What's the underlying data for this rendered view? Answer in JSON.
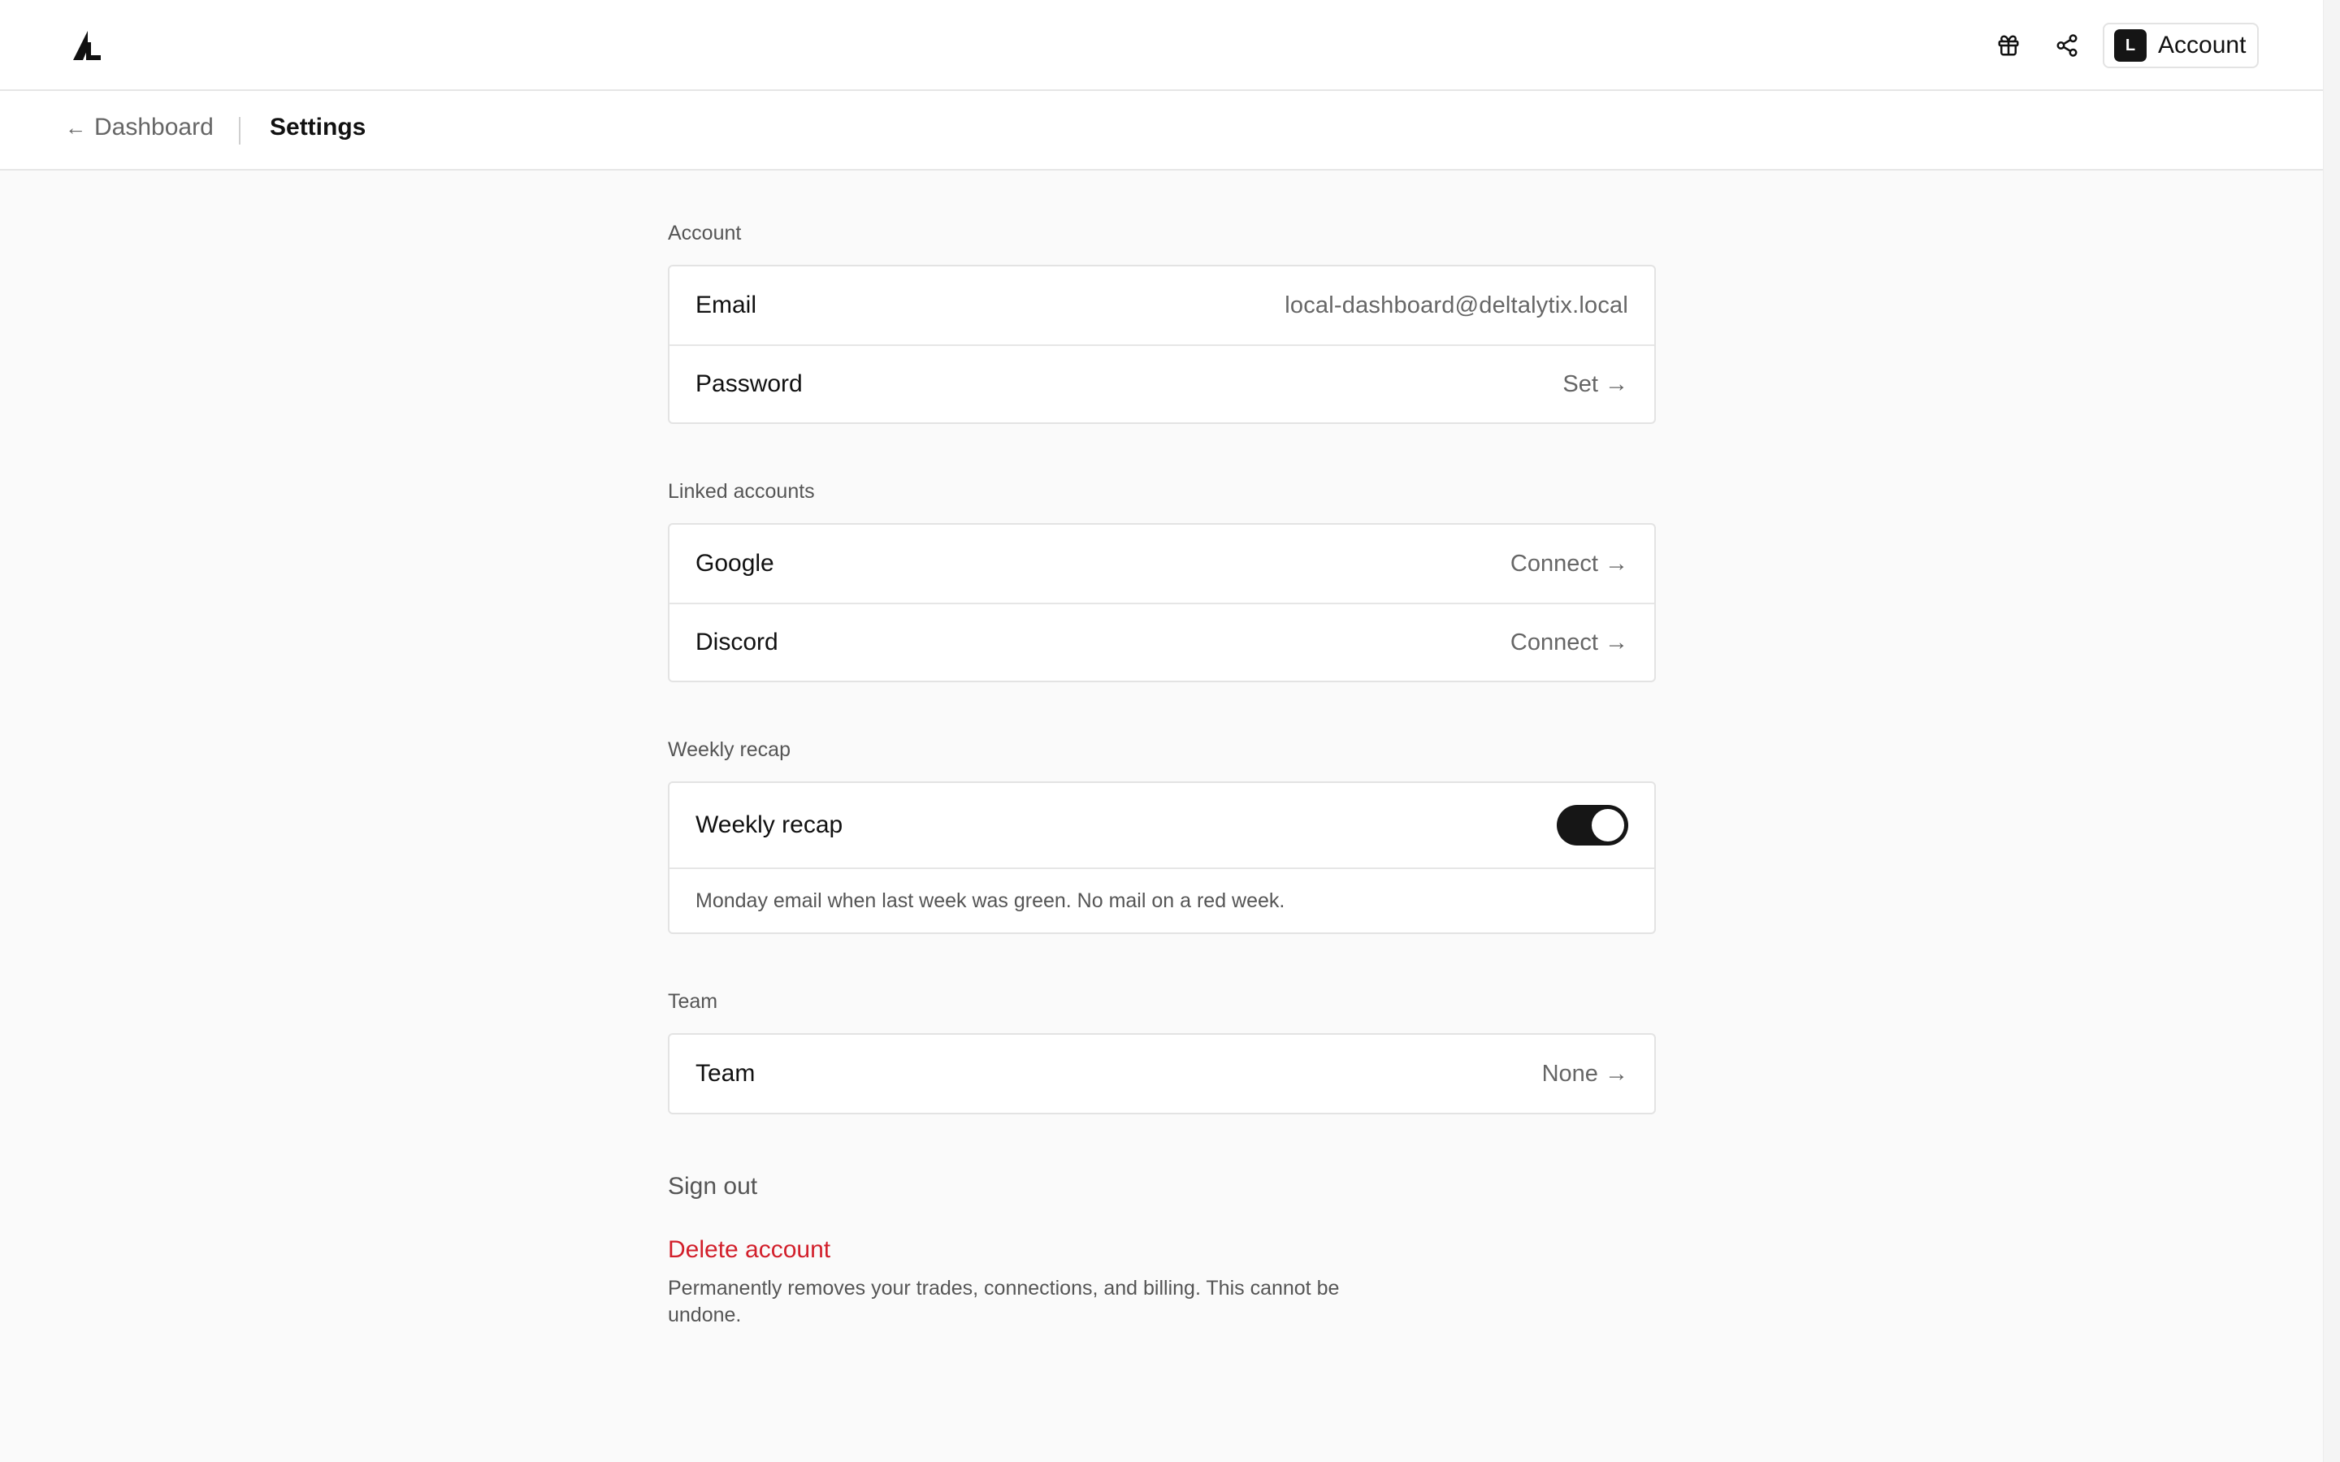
{
  "header": {
    "account_label": "Account",
    "avatar_initial": "L"
  },
  "breadcrumb": {
    "back_label": "Dashboard",
    "current": "Settings"
  },
  "sections": {
    "account": {
      "title": "Account",
      "email_label": "Email",
      "email_value": "local-dashboard@deltalytix.local",
      "password_label": "Password",
      "password_value": "Set →"
    },
    "linked": {
      "title": "Linked accounts",
      "google_label": "Google",
      "google_value": "Connect →",
      "discord_label": "Discord",
      "discord_value": "Connect →"
    },
    "weekly": {
      "title": "Weekly recap",
      "toggle_label": "Weekly recap",
      "toggle_on": true,
      "description": "Monday email when last week was green. No mail on a red week."
    },
    "team": {
      "title": "Team",
      "team_label": "Team",
      "team_value": "None →"
    }
  },
  "actions": {
    "sign_out": "Sign out",
    "delete_account": "Delete account",
    "delete_description": "Permanently removes your trades, connections, and billing. This cannot be undone."
  },
  "colors": {
    "danger": "#d21f2b",
    "toggle_on": "#161616",
    "background": "#fafafa"
  }
}
